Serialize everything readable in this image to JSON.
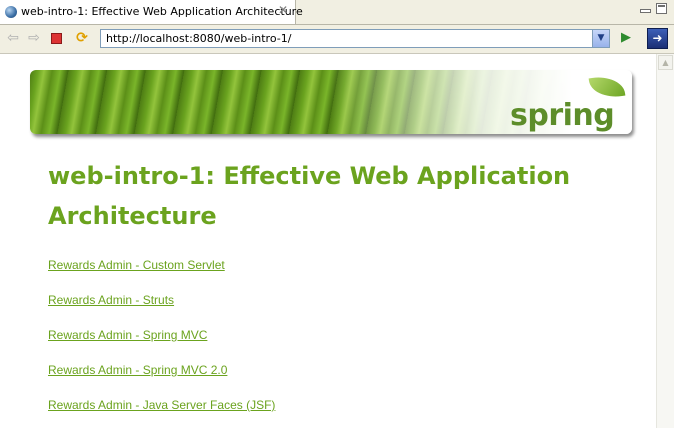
{
  "window": {
    "tab_title": "web-intro-1: Effective Web Application Architecture",
    "close_glyph": "✕"
  },
  "toolbar": {
    "url": "http://localhost:8080/web-intro-1/",
    "icons": {
      "back": "back-arrow-icon",
      "forward": "forward-arrow-icon",
      "stop": "stop-icon",
      "refresh": "refresh-icon",
      "go": "go-icon",
      "external": "external-browser-icon"
    }
  },
  "banner": {
    "logo_text": "spring",
    "accent_color": "#6ba31e"
  },
  "page": {
    "title": "web-intro-1: Effective Web Application Architecture",
    "links": [
      "Rewards Admin - Custom Servlet",
      "Rewards Admin - Struts",
      "Rewards Admin - Spring MVC",
      "Rewards Admin - Spring MVC 2.0",
      "Rewards Admin - Java Server Faces (JSF)"
    ]
  }
}
